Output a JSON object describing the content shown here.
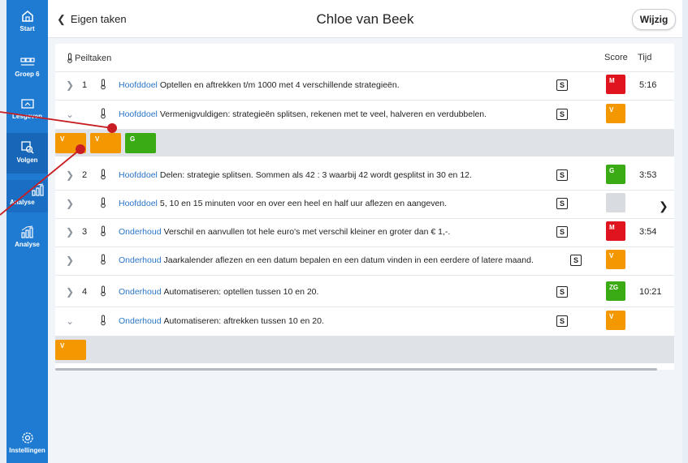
{
  "colors": {
    "sidebar": "#1f7bd2",
    "red": "#e0141e",
    "orange": "#f39800",
    "green": "#3aab15",
    "grey": "#d8dbdf",
    "category": "#2a74c6",
    "annotation": "#c81e23"
  },
  "sidebar": {
    "items": [
      {
        "label": "Start",
        "icon": "home-icon"
      },
      {
        "label": "Groep 6",
        "icon": "group-icon"
      },
      {
        "label": "Lesgeven",
        "icon": "teach-icon"
      },
      {
        "label": "Volgen",
        "icon": "follow-icon"
      },
      {
        "label": "Analyse",
        "icon": "analyse-icon"
      },
      {
        "label": "Analyse",
        "icon": "analyse-icon"
      },
      {
        "label": "Instellingen",
        "icon": "settings-icon"
      }
    ]
  },
  "header": {
    "back_label": "Eigen taken",
    "title": "Chloe van Beek",
    "edit_label": "Wijzig"
  },
  "table": {
    "section_label": "Peiltaken",
    "col_score": "Score",
    "col_tijd": "Tijd",
    "rows": [
      {
        "num": "1",
        "category": "Hoofddoel",
        "text": "Optellen en aftrekken t/m 1000 met 4 verschillende strategieën.",
        "badge": "M",
        "badge_color": "red",
        "time": "5:16",
        "expanded": false
      },
      {
        "num": "",
        "category": "Hoofddoel",
        "text": "Vermenigvuldigen: strategieën splitsen, rekenen met te veel, halveren en verdubbelen.",
        "badge": "V",
        "badge_color": "orange",
        "time": "",
        "expanded": true
      },
      {
        "num": "2",
        "category": "Hoofddoel",
        "text": "Delen: strategie splitsen. Sommen als 42 : 3 waarbij 42 wordt gesplitst in 30 en 12.",
        "badge": "G",
        "badge_color": "green",
        "time": "3:53",
        "expanded": false
      },
      {
        "num": "",
        "category": "Hoofddoel",
        "text": "5, 10 en 15 minuten voor en over een heel en half uur aflezen en aangeven.",
        "badge": "",
        "badge_color": "grey",
        "time": "",
        "expanded": false
      },
      {
        "num": "3",
        "category": "Onderhoud",
        "text": "Verschil en aanvullen tot hele euro's met verschil kleiner en groter dan € 1,-.",
        "badge": "M",
        "badge_color": "red",
        "time": "3:54",
        "expanded": false
      },
      {
        "num": "",
        "category": "Onderhoud",
        "text": "Jaarkalender aflezen en een datum bepalen en een datum vinden in een eerdere of latere maand.",
        "badge": "V",
        "badge_color": "orange",
        "time": "",
        "expanded": false
      },
      {
        "num": "4",
        "category": "Onderhoud",
        "text": "Automatiseren: optellen tussen 10 en 20.",
        "badge": "ZG",
        "badge_color": "green",
        "time": "10:21",
        "expanded": false
      },
      {
        "num": "",
        "category": "Onderhoud",
        "text": "Automatiseren: aftrekken tussen 10 en 20.",
        "badge": "V",
        "badge_color": "orange",
        "time": "",
        "expanded": true
      }
    ],
    "sub_rows": [
      {
        "chips": [
          {
            "label": "V",
            "color": "orange"
          },
          {
            "label": "V",
            "color": "orange"
          },
          {
            "label": "G",
            "color": "green"
          }
        ]
      },
      {
        "chips": [
          {
            "label": "V",
            "color": "orange"
          }
        ]
      }
    ],
    "s_label": "S"
  }
}
